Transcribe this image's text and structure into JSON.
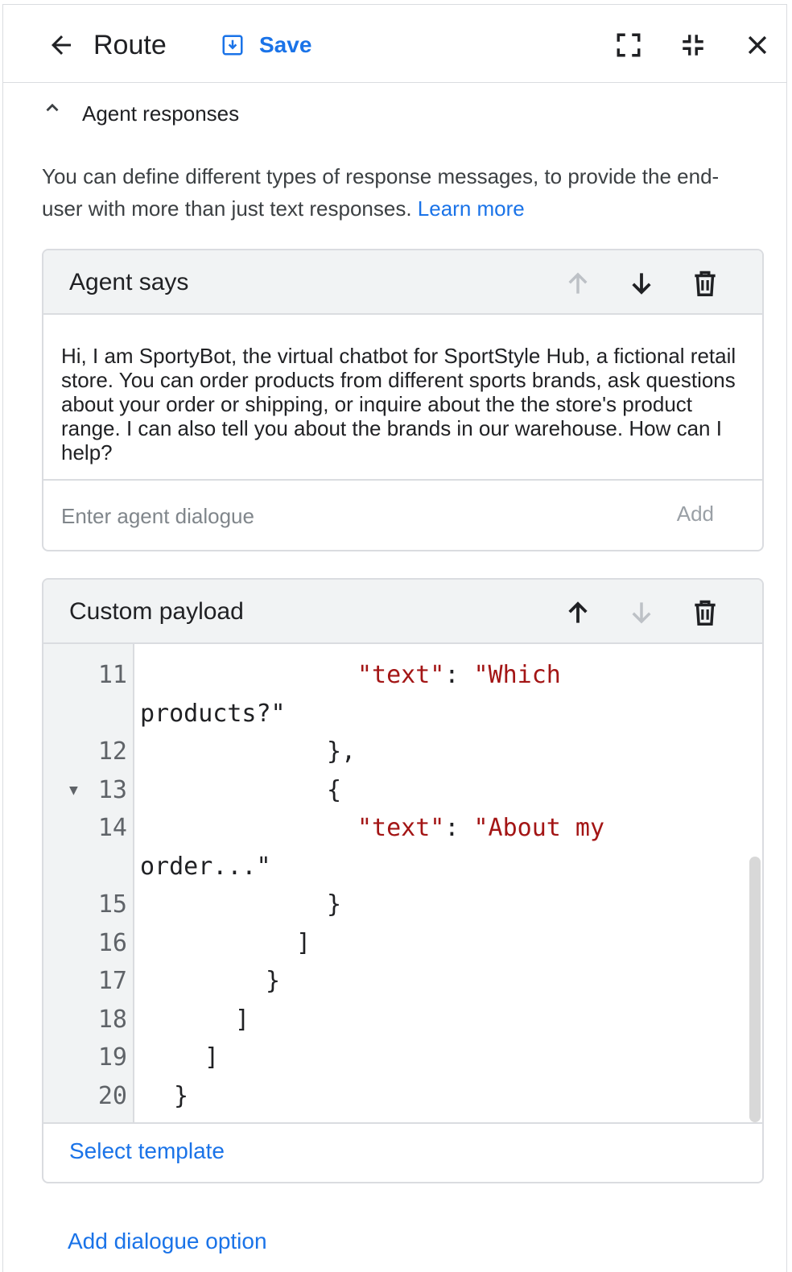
{
  "header": {
    "title": "Route",
    "save_label": "Save",
    "icons": [
      "arrow-back-icon",
      "save-icon",
      "fullscreen-icon",
      "collapse-icon",
      "close-icon"
    ]
  },
  "section": {
    "title": "Agent responses",
    "description": "You can define different types of response messages, to provide the end-user with more than just text responses.",
    "learn_more": "Learn more"
  },
  "agent_says": {
    "title": "Agent says",
    "text": "Hi, I am SportyBot, the virtual chatbot for SportStyle Hub, a fictional retail store. You can order products from different sports brands, ask questions about your order or shipping, or inquire about the the store's product range. I can also tell you about the brands in our warehouse. How can I help?",
    "input_placeholder": "Enter agent dialogue",
    "add_label": "Add"
  },
  "custom_payload": {
    "title": "Custom payload",
    "line_numbers": [
      "11",
      "",
      "12",
      "13",
      "14",
      "",
      "15",
      "16",
      "17",
      "18",
      "19",
      "20"
    ],
    "code": {
      "l11_key": "\"text\"",
      "l11_sep": ": ",
      "l11_val": "\"Which",
      "l11b_val": "products?\"",
      "l12": "},",
      "l13": "{",
      "l14_key": "\"text\"",
      "l14_sep": ": ",
      "l14_val": "\"About my",
      "l14b_val": "order...\"",
      "l15": "}",
      "l16": "]",
      "l17": "}",
      "l18": "]",
      "l19": "]",
      "l20": "}"
    },
    "select_template": "Select template"
  },
  "add_dialogue_option": "Add dialogue option",
  "colors": {
    "accent": "#1a73e8",
    "string": "#a31515",
    "border": "#dadce0",
    "card_header_bg": "#f1f3f4"
  }
}
